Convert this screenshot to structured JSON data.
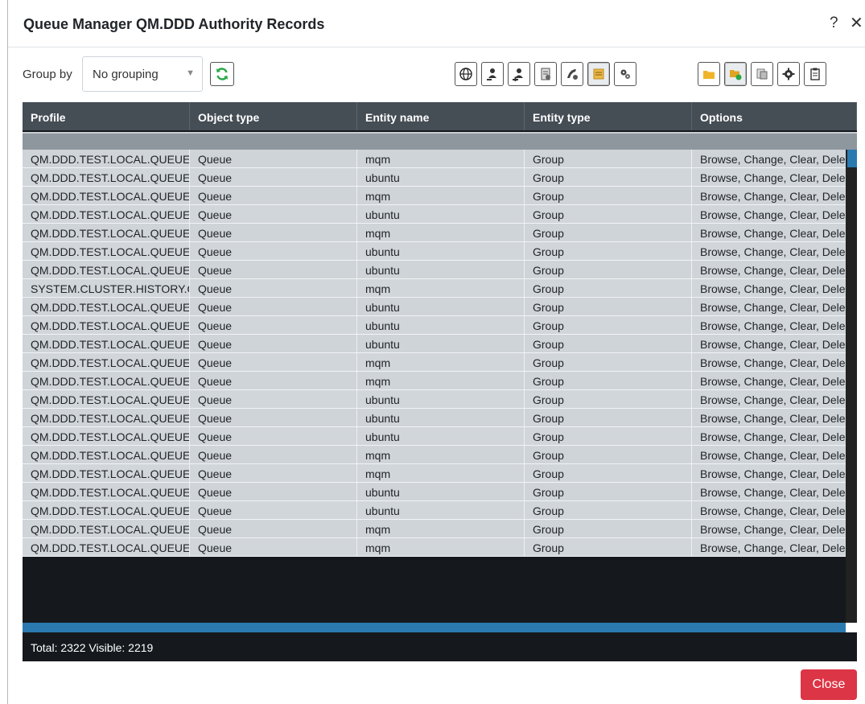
{
  "dialog": {
    "title": "Queue Manager QM.DDD Authority Records",
    "help": "?",
    "close_x": "✕"
  },
  "toolbar": {
    "group_by_label": "Group by",
    "group_by_value": "No grouping",
    "icons": [
      "globe-icon",
      "user-remove-icon",
      "user-add-icon",
      "document-icon",
      "mixed-icon",
      "notes-icon",
      "gears-icon",
      "folder-icon",
      "folder-check-icon",
      "copy-icon",
      "settings-icon",
      "clipboard-icon"
    ]
  },
  "grid": {
    "columns": [
      "Profile",
      "Object type",
      "Entity name",
      "Entity type",
      "Options"
    ],
    "rows": [
      [
        "QM.DDD.TEST.LOCAL.QUEUE.",
        "Queue",
        "mqm",
        "Group",
        "Browse, Change, Clear, Dele"
      ],
      [
        "QM.DDD.TEST.LOCAL.QUEUE.",
        "Queue",
        "ubuntu",
        "Group",
        "Browse, Change, Clear, Dele"
      ],
      [
        "QM.DDD.TEST.LOCAL.QUEUE.",
        "Queue",
        "mqm",
        "Group",
        "Browse, Change, Clear, Dele"
      ],
      [
        "QM.DDD.TEST.LOCAL.QUEUE.",
        "Queue",
        "ubuntu",
        "Group",
        "Browse, Change, Clear, Dele"
      ],
      [
        "QM.DDD.TEST.LOCAL.QUEUE.",
        "Queue",
        "mqm",
        "Group",
        "Browse, Change, Clear, Dele"
      ],
      [
        "QM.DDD.TEST.LOCAL.QUEUE.",
        "Queue",
        "ubuntu",
        "Group",
        "Browse, Change, Clear, Dele"
      ],
      [
        "QM.DDD.TEST.LOCAL.QUEUE.",
        "Queue",
        "ubuntu",
        "Group",
        "Browse, Change, Clear, Dele"
      ],
      [
        "SYSTEM.CLUSTER.HISTORY.QI",
        "Queue",
        "mqm",
        "Group",
        "Browse, Change, Clear, Dele"
      ],
      [
        "QM.DDD.TEST.LOCAL.QUEUE.",
        "Queue",
        "ubuntu",
        "Group",
        "Browse, Change, Clear, Dele"
      ],
      [
        "QM.DDD.TEST.LOCAL.QUEUE.",
        "Queue",
        "ubuntu",
        "Group",
        "Browse, Change, Clear, Dele"
      ],
      [
        "QM.DDD.TEST.LOCAL.QUEUE.",
        "Queue",
        "ubuntu",
        "Group",
        "Browse, Change, Clear, Dele"
      ],
      [
        "QM.DDD.TEST.LOCAL.QUEUE.",
        "Queue",
        "mqm",
        "Group",
        "Browse, Change, Clear, Dele"
      ],
      [
        "QM.DDD.TEST.LOCAL.QUEUE.",
        "Queue",
        "mqm",
        "Group",
        "Browse, Change, Clear, Dele"
      ],
      [
        "QM.DDD.TEST.LOCAL.QUEUE.",
        "Queue",
        "ubuntu",
        "Group",
        "Browse, Change, Clear, Dele"
      ],
      [
        "QM.DDD.TEST.LOCAL.QUEUE.",
        "Queue",
        "ubuntu",
        "Group",
        "Browse, Change, Clear, Dele"
      ],
      [
        "QM.DDD.TEST.LOCAL.QUEUE.",
        "Queue",
        "ubuntu",
        "Group",
        "Browse, Change, Clear, Dele"
      ],
      [
        "QM.DDD.TEST.LOCAL.QUEUE.",
        "Queue",
        "mqm",
        "Group",
        "Browse, Change, Clear, Dele"
      ],
      [
        "QM.DDD.TEST.LOCAL.QUEUE.",
        "Queue",
        "mqm",
        "Group",
        "Browse, Change, Clear, Dele"
      ],
      [
        "QM.DDD.TEST.LOCAL.QUEUE.",
        "Queue",
        "ubuntu",
        "Group",
        "Browse, Change, Clear, Dele"
      ],
      [
        "QM.DDD.TEST.LOCAL.QUEUE.",
        "Queue",
        "ubuntu",
        "Group",
        "Browse, Change, Clear, Dele"
      ],
      [
        "QM.DDD.TEST.LOCAL.QUEUE.",
        "Queue",
        "mqm",
        "Group",
        "Browse, Change, Clear, Dele"
      ],
      [
        "QM.DDD.TEST.LOCAL.QUEUE.",
        "Queue",
        "mqm",
        "Group",
        "Browse, Change, Clear, Dele"
      ]
    ],
    "footer": "Total: 2322 Visible: 2219"
  },
  "buttons": {
    "close": "Close"
  },
  "colors": {
    "header_bg": "#454d55",
    "grid_bg": "#15191d",
    "close_bg": "#dc3545",
    "scroll": "#2a7ab0"
  }
}
